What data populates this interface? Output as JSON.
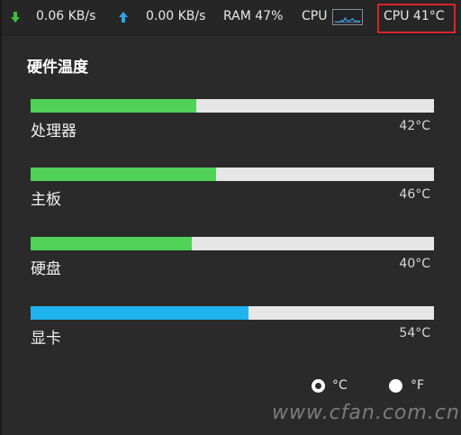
{
  "topbar": {
    "download_speed": "0.06 KB/s",
    "upload_speed": "0.00 KB/s",
    "ram": "RAM 47%",
    "cpu_label": "CPU",
    "cpu_temp": "CPU 41°C",
    "icons": {
      "download": "download-arrow-icon",
      "upload": "upload-arrow-icon"
    },
    "colors": {
      "download_arrow": "#3fbf3f",
      "upload_arrow": "#2ba3e8",
      "highlight_box": "#d9252a"
    }
  },
  "panel": {
    "title": "硬件温度",
    "items": [
      {
        "label": "处理器",
        "value": "42°C",
        "fraction": 0.41,
        "color": "#4fd257"
      },
      {
        "label": "主板",
        "value": "46°C",
        "fraction": 0.46,
        "color": "#4fd257"
      },
      {
        "label": "硬盘",
        "value": "40°C",
        "fraction": 0.4,
        "color": "#4fd257"
      },
      {
        "label": "显卡",
        "value": "54°C",
        "fraction": 0.54,
        "color": "#1fb4f0"
      }
    ]
  },
  "units": {
    "celsius": "°C",
    "fahrenheit": "°F",
    "selected": "celsius"
  },
  "watermark": "www.cfan.com.cn 广东龙网"
}
